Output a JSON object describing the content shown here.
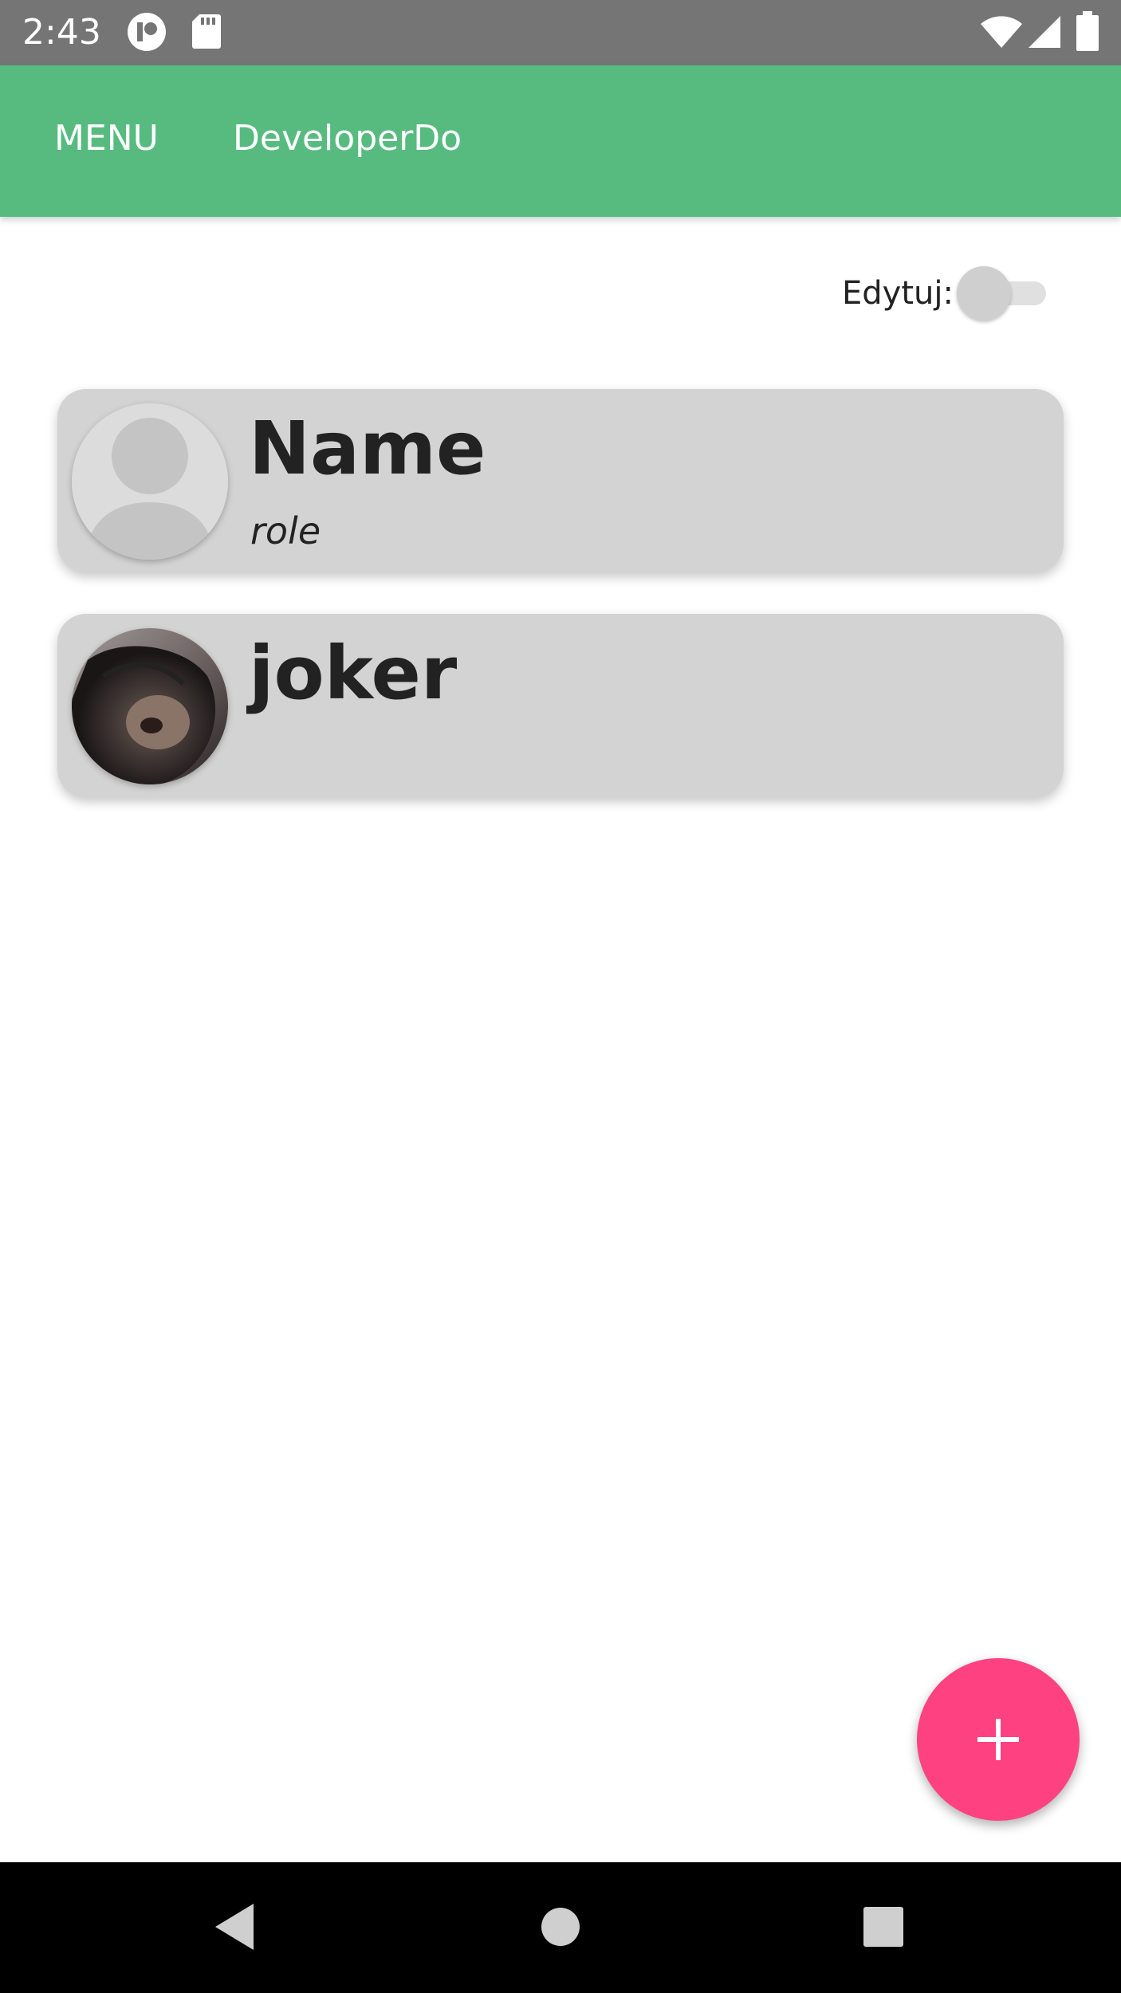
{
  "status_bar": {
    "time": "2:43",
    "icons": [
      "notification-app-icon",
      "sd-card-icon",
      "wifi-icon",
      "cellular-signal-icon",
      "battery-icon"
    ]
  },
  "app_bar": {
    "menu_label": "MENU",
    "developer_label": "DeveloperDo",
    "color": "#57bb80"
  },
  "edit_toggle": {
    "label": "Edytuj:",
    "checked": false
  },
  "list": {
    "items": [
      {
        "name": "Name",
        "role": "role",
        "avatar": "default-avatar-icon"
      },
      {
        "name": "joker",
        "role": "",
        "avatar": "photo"
      }
    ]
  },
  "fab": {
    "icon": "plus-icon",
    "color": "#fe4181"
  },
  "nav_bar": {
    "icons": [
      "back-icon",
      "home-icon",
      "recents-icon"
    ]
  }
}
